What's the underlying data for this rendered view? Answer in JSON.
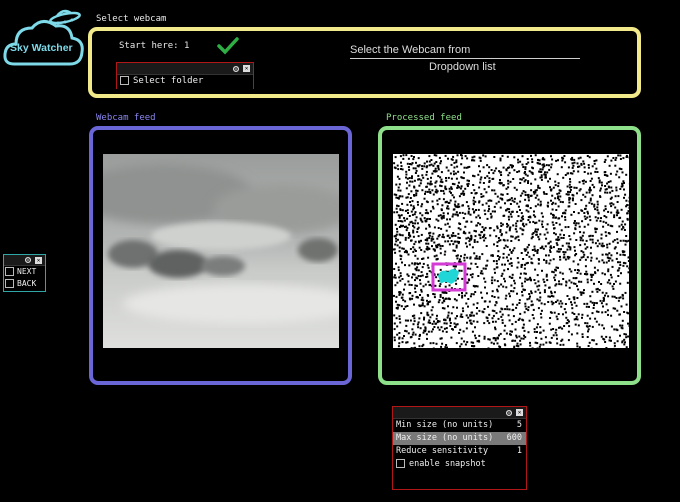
{
  "logo": {
    "text": "Sky Watcher"
  },
  "select_section": {
    "title": "Select webcam",
    "start_label": "Start here: 1",
    "select_folder_label": "Select folder",
    "hint_line1": "Select the Webcam from",
    "hint_line2": "Dropdown list"
  },
  "nav_panel": {
    "next_label": "NEXT",
    "back_label": "BACK"
  },
  "webcam_feed": {
    "title": "Webcam feed"
  },
  "processed_feed": {
    "title": "Processed feed"
  },
  "settings": {
    "rows": [
      {
        "label": "Min size (no units)",
        "value": "5"
      },
      {
        "label": "Max size (no units)",
        "value": "600"
      },
      {
        "label": "Reduce sensitivity",
        "value": "1"
      }
    ],
    "snapshot_label": "enable snapshot"
  },
  "colors": {
    "select_frame": "#f2e98a",
    "webcam_frame": "#6b66d6",
    "processed_frame": "#8ee08a",
    "logo": "#7ed9e8",
    "checkmark": "#2fae45",
    "control_border": "#b01818",
    "detection_box": "#d43ad4",
    "detection_blob": "#20d6d6"
  },
  "icons": [
    "ufo-icon",
    "cloud-icon",
    "checkmark-icon",
    "gear-icon",
    "close-icon"
  ]
}
